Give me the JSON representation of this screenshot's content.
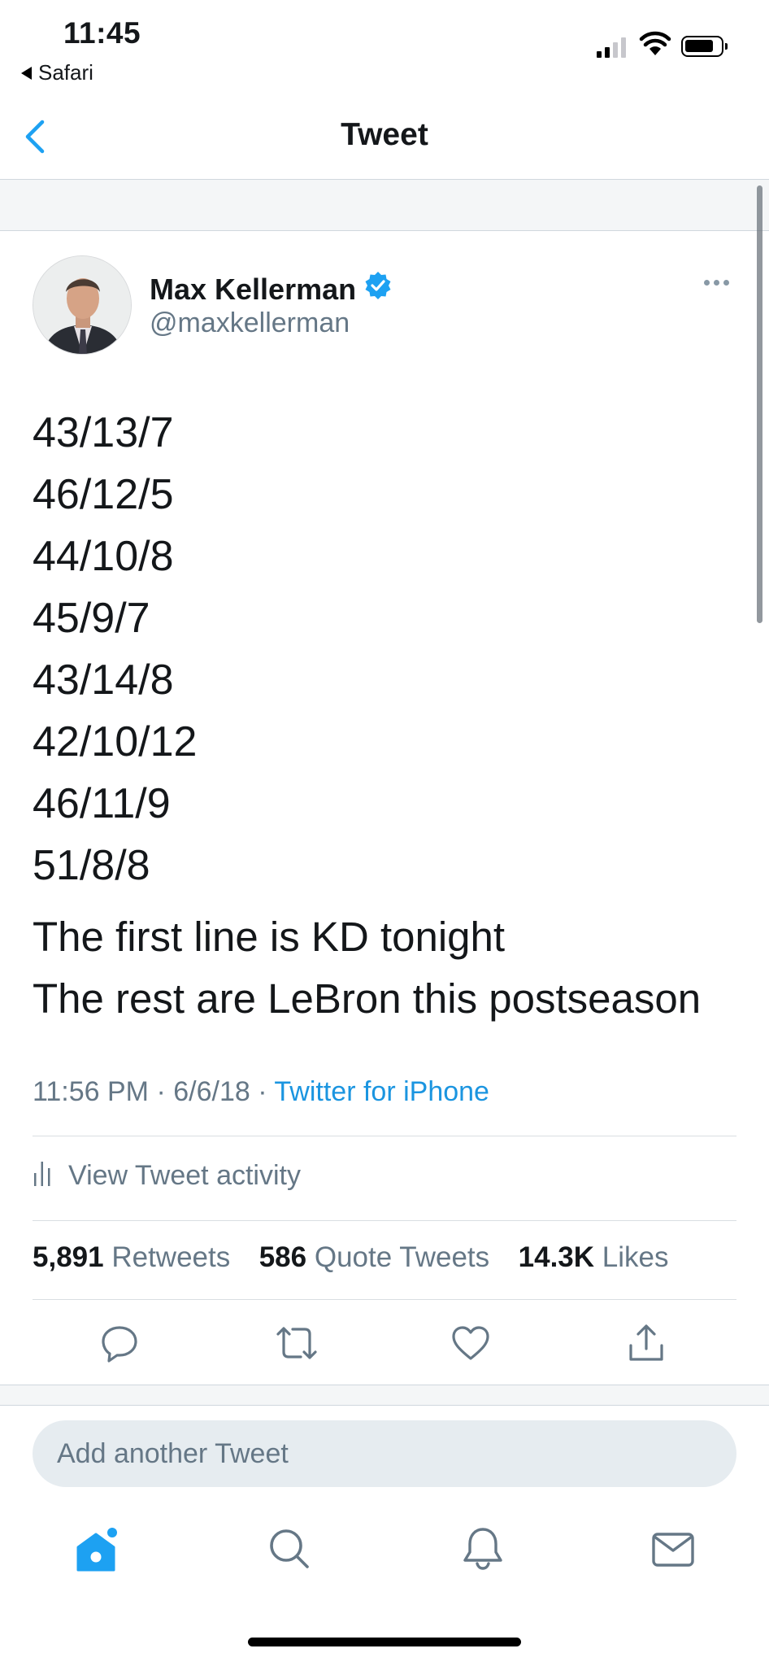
{
  "status_bar": {
    "time": "11:45",
    "back_app": "Safari"
  },
  "nav": {
    "title": "Tweet"
  },
  "tweet": {
    "author": {
      "display_name": "Max Kellerman",
      "handle": "@maxkellerman",
      "verified": true
    },
    "lines": [
      "43/13/7",
      "46/12/5",
      "44/10/8",
      "45/9/7",
      "43/14/8",
      "42/10/12",
      "46/11/9",
      "51/8/8"
    ],
    "text_lines": [
      "The first line is KD tonight",
      "The rest are LeBron this postseason"
    ],
    "time": "11:56 PM",
    "date": "6/6/18",
    "source": "Twitter for iPhone",
    "activity_label": "View Tweet activity",
    "stats": {
      "retweets_count": "5,891",
      "retweets_label": "Retweets",
      "quotes_count": "586",
      "quotes_label": "Quote Tweets",
      "likes_count": "14.3K",
      "likes_label": "Likes"
    }
  },
  "reply": {
    "placeholder": "Add another Tweet"
  },
  "colors": {
    "accent": "#1da1f2",
    "link": "#1b95e0",
    "secondary_text": "#657786"
  },
  "icons": [
    "back-chevron-icon",
    "verified-badge-icon",
    "more-icon",
    "activity-bars-icon",
    "reply-icon",
    "retweet-icon",
    "like-icon",
    "share-icon",
    "home-icon",
    "search-icon",
    "notifications-icon",
    "messages-icon"
  ]
}
